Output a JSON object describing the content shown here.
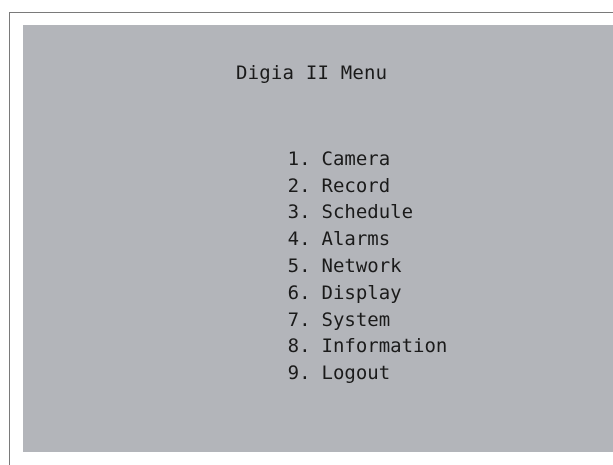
{
  "menu": {
    "title": "Digia II Menu",
    "items": [
      {
        "number": "1.",
        "label": "Camera"
      },
      {
        "number": "2.",
        "label": "Record"
      },
      {
        "number": "3.",
        "label": "Schedule"
      },
      {
        "number": "4.",
        "label": "Alarms"
      },
      {
        "number": "5.",
        "label": "Network"
      },
      {
        "number": "6.",
        "label": "Display"
      },
      {
        "number": "7.",
        "label": "System"
      },
      {
        "number": "8.",
        "label": "Information"
      },
      {
        "number": "9.",
        "label": "Logout"
      }
    ]
  },
  "colors": {
    "screen_background": "#b3b5ba",
    "text": "#1a1a1a",
    "frame_border": "#7a7a7a"
  }
}
